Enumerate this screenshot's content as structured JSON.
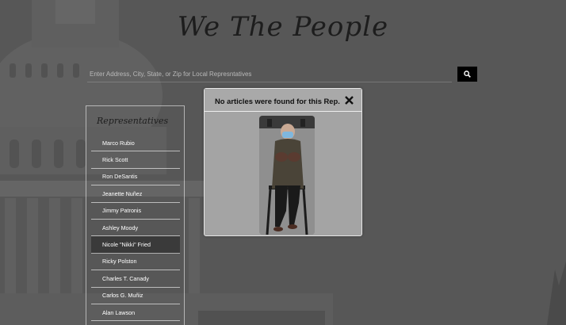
{
  "site": {
    "title": "We The People"
  },
  "search": {
    "placeholder": "Enter Address, City, State, or Zip for Local Represntatives",
    "button_icon": "search-icon"
  },
  "representatives": {
    "heading": "Representatives",
    "selected": "Nicole \"Nikki\" Fried",
    "items": [
      {
        "label": "Marco Rubio"
      },
      {
        "label": "Rick Scott"
      },
      {
        "label": "Ron DeSantis"
      },
      {
        "label": "Jeanette Nuñez"
      },
      {
        "label": "Jimmy Patronis"
      },
      {
        "label": "Ashley Moody"
      },
      {
        "label": "Nicole \"Nikki\" Fried"
      },
      {
        "label": "Ricky Polston"
      },
      {
        "label": "Charles T. Canady"
      },
      {
        "label": "Carlos G. Muñiz"
      },
      {
        "label": "Alan Lawson"
      }
    ]
  },
  "modal": {
    "message": "No articles were found for this Rep.",
    "close_icon": "close-icon",
    "photo": "representative-photo"
  },
  "colors": {
    "search_button": "#000000",
    "active_item": "#3a3a3a",
    "modal_bg": "#a4a4a4"
  }
}
